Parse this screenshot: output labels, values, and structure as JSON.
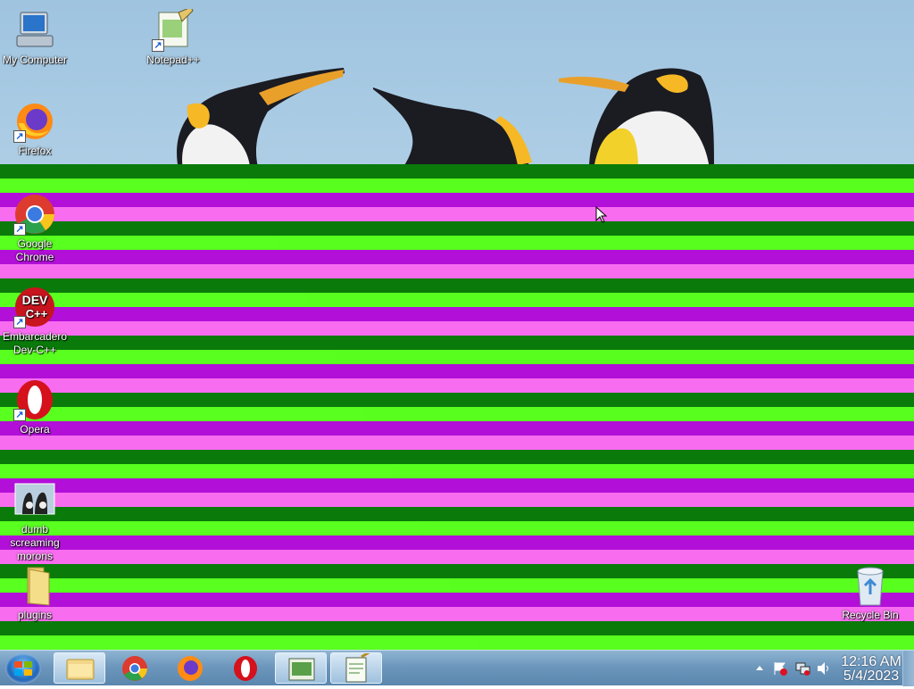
{
  "desktop": {
    "icons": [
      {
        "label": "My Computer",
        "icon": "computer-icon"
      },
      {
        "label": "Notepad++",
        "icon": "notepadpp-icon"
      },
      {
        "label": "Firefox",
        "icon": "firefox-icon"
      },
      {
        "label": "Google Chrome",
        "icon": "chrome-icon"
      },
      {
        "label": "Embarcadero Dev-C++",
        "icon": "devcpp-icon",
        "logo_text": "DEV C++"
      },
      {
        "label": "Opera",
        "icon": "opera-icon"
      },
      {
        "label": "dumb screaming morons",
        "icon": "image-file-icon"
      },
      {
        "label": "plugins",
        "icon": "folder-icon"
      },
      {
        "label": "Recycle Bin",
        "icon": "recycle-bin-icon"
      }
    ]
  },
  "taskbar": {
    "pinned": [
      {
        "name": "Windows Explorer",
        "icon": "folder-icon"
      },
      {
        "name": "Google Chrome",
        "icon": "chrome-icon"
      },
      {
        "name": "Firefox",
        "icon": "firefox-icon"
      },
      {
        "name": "Opera",
        "icon": "opera-icon"
      },
      {
        "name": "Notepad++ (running)",
        "icon": "notepadpp-icon"
      },
      {
        "name": "Notepad",
        "icon": "notepad-icon"
      }
    ],
    "clock": {
      "time": "12:16 AM",
      "date": "5/4/2023"
    }
  },
  "colors": {
    "stripe_dark_green": "#0a7a0a",
    "stripe_lime": "#58ff1f",
    "stripe_purple": "#b20fd8",
    "stripe_pink": "#f86cf0",
    "taskbar": "#6d97bd"
  }
}
